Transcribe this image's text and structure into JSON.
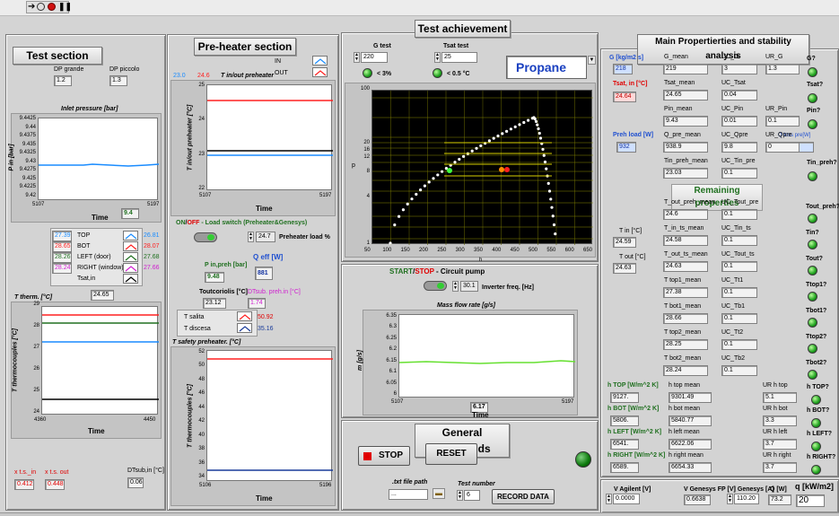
{
  "toolbar": {
    "run": "run-arrow-icon",
    "run_cont": "run-continuous-icon",
    "abort": "abort-icon",
    "pause": "pause-icon"
  },
  "test_section": {
    "title": "Test section",
    "dp_grande_label": "DP grande",
    "dp_grande": "1.2",
    "dp_piccolo_label": "DP piccolo",
    "dp_piccolo": "1.3",
    "inlet_title": "Inlet pressure [bar]",
    "inlet_ylabel": "P in [bar]",
    "inlet_xlabel": "Time",
    "inlet_value": "9.4",
    "inlet_yticks": [
      "9.4425",
      "9.44",
      "9.4375",
      "9.435",
      "9.4325",
      "9.43",
      "9.4275",
      "9.425",
      "9.4225",
      "9.42"
    ],
    "inlet_xticks": [
      "5107",
      "5197"
    ],
    "therm_rows": [
      {
        "left": "27.39",
        "name": "TOP",
        "right": "26.81",
        "color": "#1a8cff"
      },
      {
        "left": "28.65",
        "name": "BOT",
        "right": "28.07",
        "color": "#ff2020"
      },
      {
        "left": "28.26",
        "name": "LEFT (door)",
        "right": "27.68",
        "color": "#207020"
      },
      {
        "left": "28.24",
        "name": "RIGHT (window)",
        "right": "27.66",
        "color": "#d020d0"
      },
      {
        "left": "",
        "name": "Tsat,in",
        "right": "",
        "color": "#000000"
      }
    ],
    "tsat_value": "24.65",
    "therm_title": "T therm. [°C]",
    "therm_ylabel": "T thermocouples [°C]",
    "therm_xlabel": "Time",
    "therm_yticks": [
      "29",
      "28",
      "27",
      "26",
      "25",
      "24"
    ],
    "therm_xticks": [
      "4360",
      "4450"
    ],
    "xts_in_label": "x t.s._in",
    "xts_in": "0.412",
    "xts_out_label": "x t.s. out",
    "xts_out": "0.448",
    "dtsub_label": "DTsub,in [°C]",
    "dtsub": "0.06"
  },
  "preheater": {
    "title": "Pre-heater section",
    "in_label": "IN",
    "out_label": "OUT",
    "in_val": "23.0",
    "out_val": "24.6",
    "tinout_title": "T in/out preheater",
    "ylabel": "T in/out preheater [°C]",
    "xlabel": "Time",
    "yticks": [
      "25",
      "24",
      "23",
      "22"
    ],
    "xticks": [
      "5107",
      "5197"
    ],
    "switch_on": "ON",
    "switch_sep": "/",
    "switch_off": "OFF",
    "switch_rest": " - Load switch (Preheater&Genesys)",
    "load_val": "24.7",
    "load_label": "Preheater load %",
    "pin_label": "P in,preh [bar]",
    "pin_val": "9.48",
    "qeff_label": "Q eff [W]",
    "qeff_val": "881",
    "tcor_label": "Toutcoriolis [°C]",
    "tcor_val": "23.12",
    "dtsub_label": "DTsub. preh.in [°C]",
    "dtsub_val": "1.74",
    "tsalita_label": "T salita",
    "tsalita_val": "50.92",
    "tdiscesa_label": "T discesa",
    "tdiscesa_val": "35.16",
    "safety_title": "T safety preheater. [°C]",
    "safety_ylabel": "T thermocouples [°C]",
    "safety_xlabel": "Time",
    "safety_yticks": [
      "52",
      "50",
      "48",
      "46",
      "44",
      "42",
      "40",
      "38",
      "36",
      "34"
    ],
    "safety_xticks": [
      "5106",
      "5196"
    ]
  },
  "achievement": {
    "title": "Test achievement",
    "g_test_label": "G test",
    "g_test": "220",
    "tsat_test_label": "Tsat test",
    "tsat_test": "25",
    "g_tol": "< 3%",
    "t_tol": "< 0.5 °C",
    "fluid": "Propane",
    "ph_ylabel": "p",
    "ph_xlabel": "h",
    "ph_yticks": [
      "100",
      "20",
      "16",
      "12",
      "8",
      "4",
      "1"
    ],
    "ph_xticks": [
      "50",
      "100",
      "150",
      "200",
      "250",
      "300",
      "350",
      "400",
      "450",
      "500",
      "550",
      "600",
      "650"
    ]
  },
  "pump": {
    "start": "START",
    "sep": "/",
    "stop": "STOP",
    "rest": " - Circuit pump",
    "freq_val": "30.1",
    "freq_label": "Inverter freq. [Hz]",
    "mflow_title": "Mass flow rate [g/s]",
    "ylabel": "m [g/s]",
    "xlabel": "Time",
    "yticks": [
      "6.35",
      "6.3",
      "6.25",
      "6.2",
      "6.15",
      "6.1",
      "6.05",
      "6"
    ],
    "xticks": [
      "5107",
      "5197"
    ],
    "value": "6.17"
  },
  "commands": {
    "title": "General commands",
    "stop": "STOP",
    "reset": "RESET",
    "path_label": ".txt file path",
    "path_val": "...",
    "testnum_label": "Test number",
    "testnum_val": "6",
    "record": "RECORD DATA"
  },
  "main": {
    "title": "Main Propertierties and stability analysis",
    "g_label": "G [kg/m2 s]",
    "g_val": "218",
    "tsatin_label": "Tsat, in [°C]",
    "tsatin_val": "24.64",
    "preh_label": "Preh load [W]",
    "preh_val": "932",
    "tin_label": "T in [°C]",
    "tin_val": "24.59",
    "tout_label": "T out [°C]",
    "tout_val": "24.63",
    "rows": [
      {
        "a": "G_mean",
        "av": "219",
        "b": "UC_G",
        "bv": "3",
        "c": "UR_G",
        "cv": "1.3",
        "d": "G?"
      },
      {
        "a": "Tsat_mean",
        "av": "24.65",
        "b": "UC_Tsat",
        "bv": "0.04",
        "c": "",
        "cv": "",
        "d": "Tsat?"
      },
      {
        "a": "Pin_mean",
        "av": "9.43",
        "b": "UC_Pin",
        "bv": "0.01",
        "c": "UR_Pin",
        "cv": "0.1",
        "d": "Pin?"
      },
      {
        "a": "Q_pre_mean",
        "av": "938.9",
        "b": "UC_Qpre",
        "bv": "9.8",
        "c": "UR_Qpre",
        "cv": "0",
        "d": ""
      },
      {
        "a": "Tin_preh_mean",
        "av": "23.03",
        "b": "UC_Tin_pre",
        "bv": "0.1",
        "c": "",
        "cv": "",
        "d": "Tin_preh?"
      }
    ],
    "qloss_label": "Q loss pre[W]",
    "qloss_val": "51",
    "remaining_title": "Remaining properties",
    "rows2": [
      {
        "a": "T_out_preh_mean",
        "av": "24.6",
        "b": "UC_Tout_pre",
        "bv": "0.1",
        "d": "Tout_preh?"
      },
      {
        "a": "T_in_ts_mean",
        "av": "24.58",
        "b": "UC_Tin_ts",
        "bv": "0.1",
        "d": "Tin?"
      },
      {
        "a": "T_out_ts_mean",
        "av": "24.63",
        "b": "UC_Tout_ts",
        "bv": "0.1",
        "d": "Tout?"
      },
      {
        "a": "T top1_mean",
        "av": "27.38",
        "b": "UC_Tt1",
        "bv": "0.1",
        "d": "Ttop1?"
      },
      {
        "a": "T bot1_mean",
        "av": "28.66",
        "b": "UC_Tb1",
        "bv": "0.1",
        "d": "Tbot1?"
      },
      {
        "a": "T top2_mean",
        "av": "28.25",
        "b": "UC_Tt2",
        "bv": "0.1",
        "d": "Ttop2?"
      },
      {
        "a": "T bot2_mean",
        "av": "28.24",
        "b": "UC_Tb2",
        "bv": "0.1",
        "d": "Tbot2?"
      }
    ],
    "htc": [
      {
        "l": "h TOP [W/m^2 K]",
        "lv": "9127.",
        "m": "h top mean",
        "mv": "9301.49",
        "u": "UR h top",
        "uv": "5.1",
        "q": "h TOP?"
      },
      {
        "l": "h BOT [W/m^2 K]",
        "lv": "5806.",
        "m": "h bot mean",
        "mv": "5840.77",
        "u": "UR h bot",
        "uv": "3.3",
        "q": "h BOT?"
      },
      {
        "l": "h LEFT [W/m^2 K]",
        "lv": "6541.",
        "m": "h left mean",
        "mv": "6622.06",
        "u": "UR h left",
        "uv": "3.7",
        "q": "h LEFT?"
      },
      {
        "l": "h RIGHT [W/m^2 K]",
        "lv": "6589.",
        "m": "h right mean",
        "mv": "6654.33",
        "u": "UR h right",
        "uv": "3.7",
        "q": "h RIGHT?"
      }
    ],
    "bottom": {
      "va_label": "V Agilent [V]",
      "va": "0.0000",
      "vg_label": "V Genesys FP [V]",
      "vg": "0.6638",
      "ig_label": "I Genesys [A]",
      "ig": "110.20",
      "q_label": "Q [W]",
      "q": "73.2",
      "qq_label": "q [kW/m2]",
      "qq": "20"
    }
  }
}
